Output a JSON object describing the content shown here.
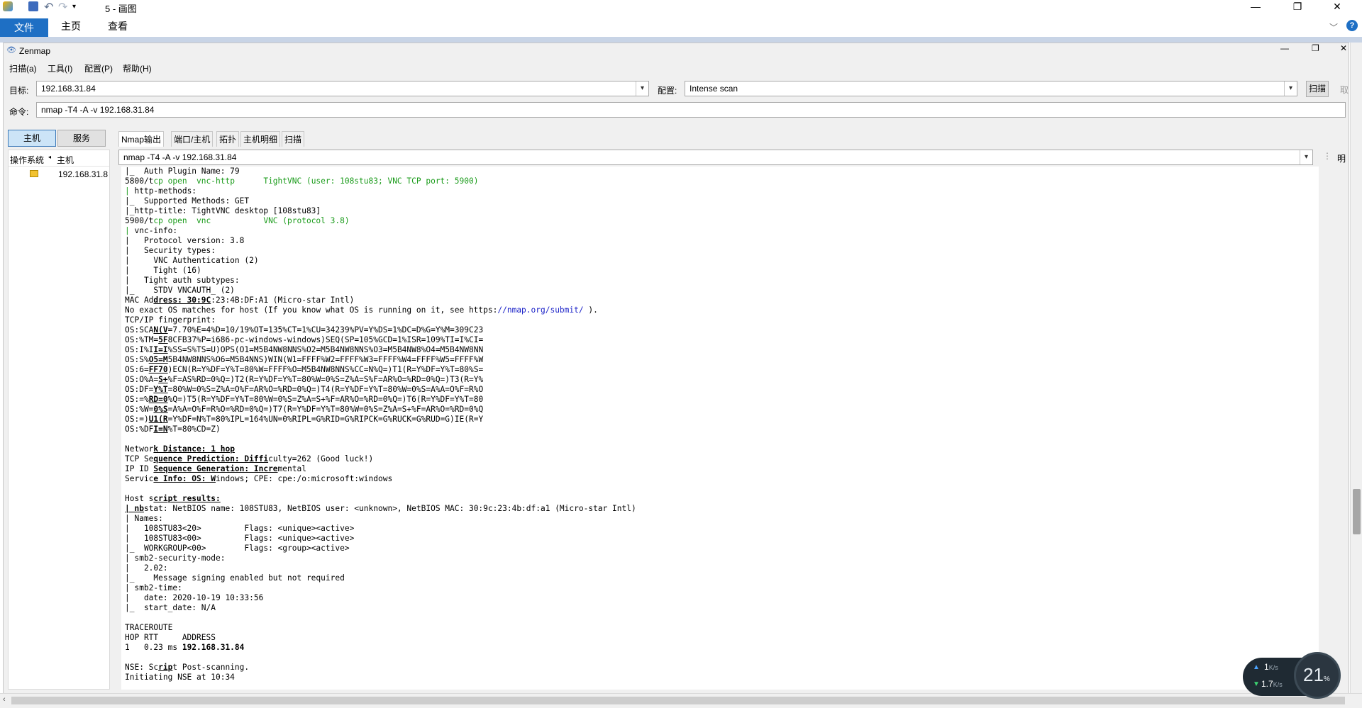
{
  "paint": {
    "title": "5 - 画图",
    "tabs": {
      "file": "文件",
      "home": "主页",
      "view": "查看"
    },
    "help": "?"
  },
  "zenmap": {
    "title": "Zenmap",
    "menu": [
      "扫描(a)",
      "工具(I)",
      "配置(P)",
      "帮助(H)"
    ],
    "target_label": "目标:",
    "target_value": "192.168.31.84",
    "profile_label": "配置:",
    "profile_value": "Intense scan",
    "scan_button": "扫描",
    "cancel_button": "取",
    "command_label": "命令:",
    "command_value": "nmap -T4 -A -v 192.168.31.84",
    "left_tabs": {
      "hosts": "主机",
      "services": "服务"
    },
    "host_columns": {
      "os": "操作系统",
      "host": "主机"
    },
    "hosts": [
      "192.168.31.8"
    ],
    "output_tabs": [
      "Nmap输出",
      "端口/主机",
      "拓扑",
      "主机明细",
      "扫描"
    ],
    "output_command": "nmap -T4 -A -v 192.168.31.84",
    "details_button": "明"
  },
  "netmon": {
    "up": "1",
    "up_unit": "K/s",
    "down": "1.7",
    "down_unit": "K/s",
    "percent": "21",
    "percent_unit": "%"
  }
}
